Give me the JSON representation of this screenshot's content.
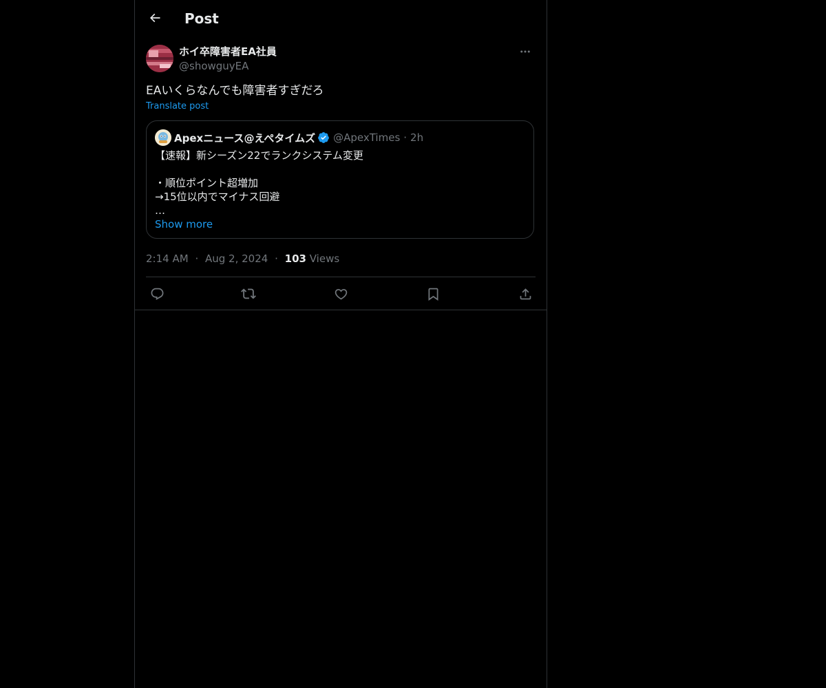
{
  "header": {
    "title": "Post",
    "back_icon": "arrow-left-icon"
  },
  "post": {
    "author": {
      "display_name": "ホイ卒障害者EA社員",
      "handle": "@showguyEA"
    },
    "text": "EAいくらなんでも障害者すぎだろ",
    "translate_label": "Translate post",
    "quote": {
      "author_name": "Apexニュース@えぺタイムズ",
      "verified": true,
      "handle": "@ApexTimes",
      "separator": "·",
      "time": "2h",
      "body": "【速報】新シーズン22でランクシステム変更\n\n・順位ポイント超増加\n→15位以内でマイナス回避\n…",
      "show_more_label": "Show more"
    },
    "meta": {
      "time": "2:14 AM",
      "separator": "·",
      "date": "Aug 2, 2024",
      "views_count": "103",
      "views_label": "Views"
    },
    "actions": [
      "reply-icon",
      "repost-icon",
      "like-icon",
      "bookmark-icon",
      "share-icon"
    ]
  },
  "colors": {
    "background": "#000000",
    "text_primary": "#e7e9ea",
    "text_secondary": "#71767b",
    "link": "#1d9bf0",
    "border": "#2f3336"
  }
}
